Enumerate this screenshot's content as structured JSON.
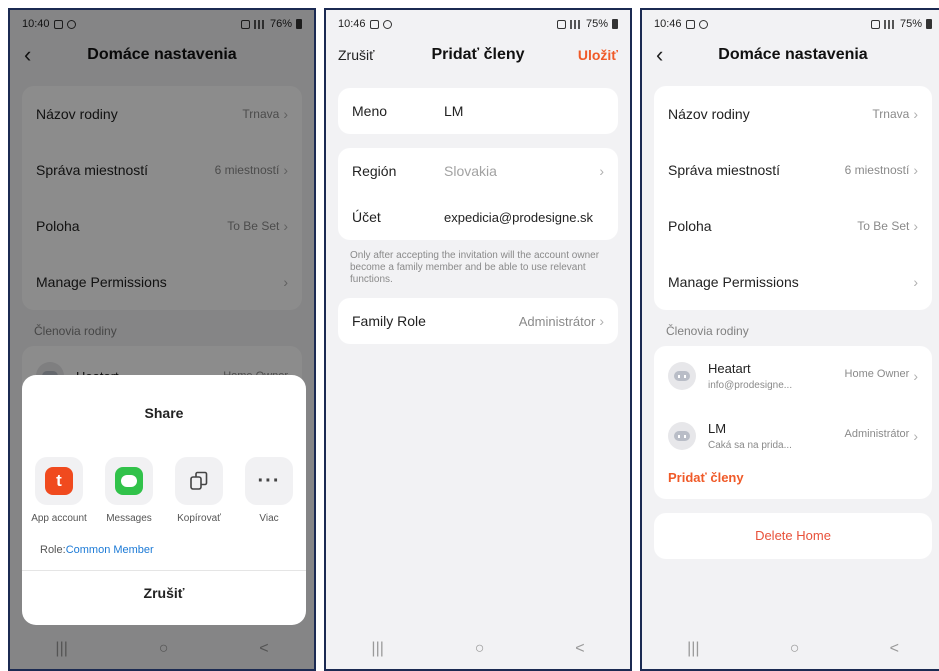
{
  "colors": {
    "accent": "#f05a28",
    "link": "#1c7ad6",
    "frame": "#1b2a52"
  },
  "screen1": {
    "status": {
      "time": "10:40",
      "battery": "76%"
    },
    "title": "Domáce nastavenia",
    "rows": [
      {
        "label": "Názov rodiny",
        "value": "Trnava"
      },
      {
        "label": "Správa miestností",
        "value": "6 miestností"
      },
      {
        "label": "Poloha",
        "value": "To Be Set"
      },
      {
        "label": "Manage Permissions",
        "value": ""
      }
    ],
    "members_label": "Členovia rodiny",
    "partial_member": {
      "name": "Heatart",
      "role": "Home Owner"
    },
    "share": {
      "title": "Share",
      "apps": [
        {
          "label": "App account",
          "icon": "tuya-app-icon"
        },
        {
          "label": "Messages",
          "icon": "messages-icon"
        },
        {
          "label": "Kopírovať",
          "icon": "copy-icon"
        },
        {
          "label": "Viac",
          "icon": "more-icon"
        }
      ],
      "role_prefix": "Role:",
      "role_value": "Common Member",
      "cancel": "Zrušiť"
    }
  },
  "screen2": {
    "status": {
      "time": "10:46",
      "battery": "75%"
    },
    "left": "Zrušiť",
    "title": "Pridať členy",
    "right": "Uložiť",
    "name": {
      "label": "Meno",
      "value": "LM"
    },
    "region": {
      "label": "Región",
      "value": "Slovakia"
    },
    "account": {
      "label": "Účet",
      "value": "expedicia@prodesigne.sk"
    },
    "note": "Only after accepting the invitation will the account owner become a family member and be able to use relevant functions.",
    "family_role": {
      "label": "Family Role",
      "value": "Administrátor"
    }
  },
  "screen3": {
    "status": {
      "time": "10:46",
      "battery": "75%"
    },
    "title": "Domáce nastavenia",
    "rows": [
      {
        "label": "Názov rodiny",
        "value": "Trnava"
      },
      {
        "label": "Správa miestností",
        "value": "6 miestností"
      },
      {
        "label": "Poloha",
        "value": "To Be Set"
      },
      {
        "label": "Manage Permissions",
        "value": ""
      }
    ],
    "members_label": "Členovia rodiny",
    "members": [
      {
        "name": "Heatart",
        "sub": "info@prodesigne...",
        "role": "Home Owner"
      },
      {
        "name": "LM",
        "sub": "Čaká sa na prida...",
        "role": "Administrátor"
      }
    ],
    "add_member": "Pridať členy",
    "delete_home": "Delete Home"
  },
  "navbar": {
    "recents": "|||",
    "home": "○",
    "back": "<"
  }
}
